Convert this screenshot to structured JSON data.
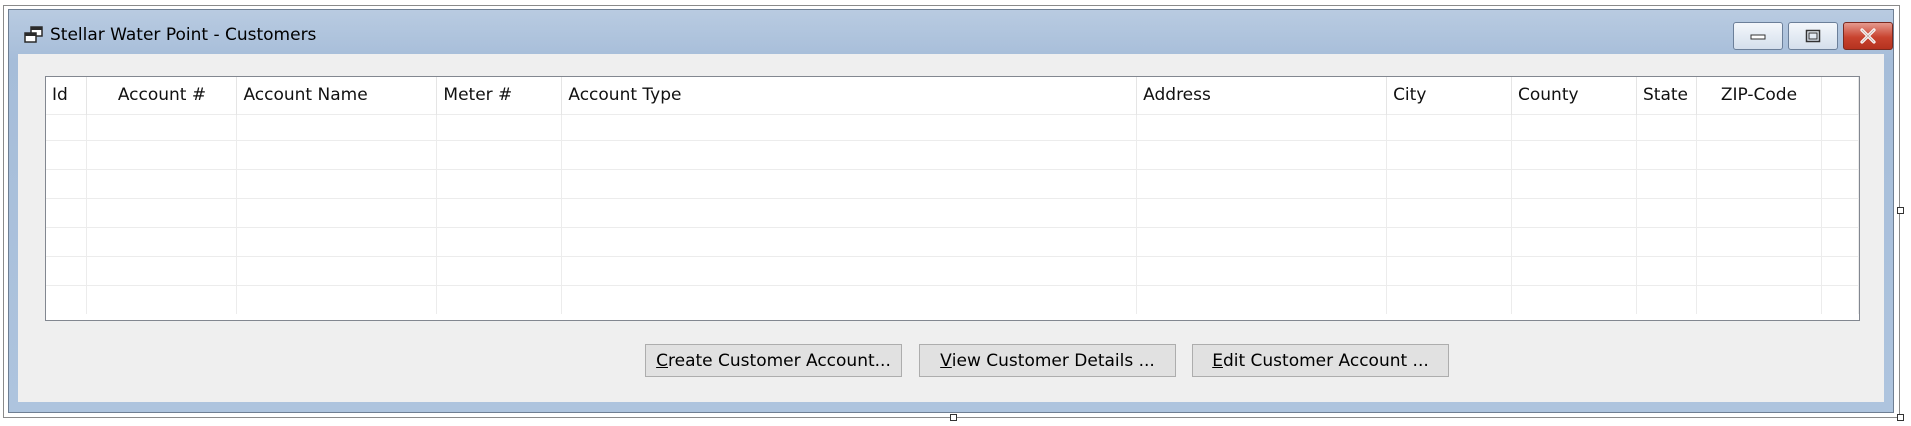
{
  "window": {
    "title": "Stellar Water Point - Customers",
    "icon": "form-icon",
    "controls": [
      {
        "name": "minimize-button",
        "icon": "minimize-icon"
      },
      {
        "name": "maximize-button",
        "icon": "maximize-icon"
      },
      {
        "name": "close-button",
        "icon": "close-icon"
      }
    ]
  },
  "grid": {
    "columns": [
      "Id",
      "Account #",
      "Account Name",
      "Meter #",
      "Account Type",
      "Address",
      "City",
      "County",
      "State",
      "ZIP-Code"
    ],
    "rows": []
  },
  "buttons": {
    "create": {
      "mnemonic": "C",
      "rest": "reate Customer Account..."
    },
    "view": {
      "mnemonic": "V",
      "rest": "iew Customer Details ..."
    },
    "edit": {
      "mnemonic": "E",
      "rest": "dit Customer Account ..."
    }
  },
  "colors": {
    "titlebar": "#a6bdd9",
    "client": "#efefef",
    "close_button": "#c8432f",
    "button_face": "#e1e1e1"
  }
}
